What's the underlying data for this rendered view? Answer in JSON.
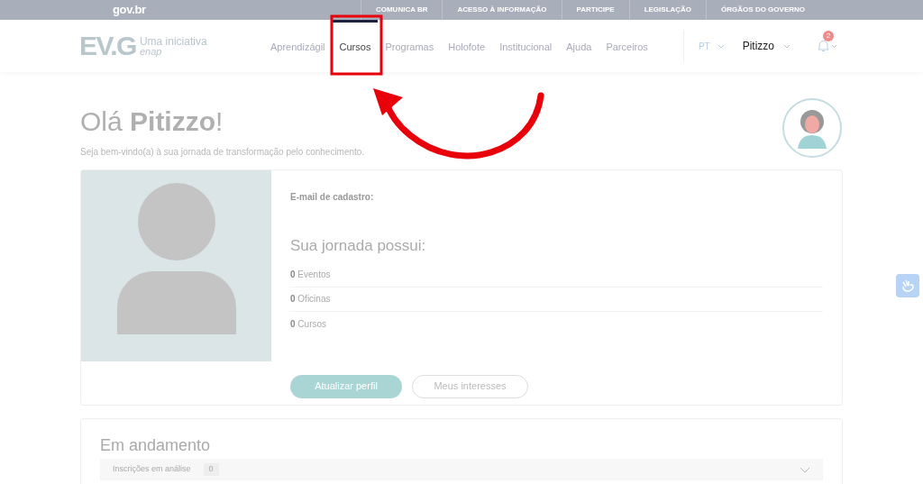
{
  "gov_bar": {
    "logo": "gov.br",
    "links": [
      "COMUNICA BR",
      "ACESSO À INFORMAÇÃO",
      "PARTICIPE",
      "LEGISLAÇÃO",
      "ÓRGÃOS DO GOVERNO"
    ]
  },
  "header": {
    "logo": {
      "mark": "EV.G",
      "tagline": "Uma iniciativa",
      "partner": "enap"
    },
    "nav": [
      {
        "label": "Aprendizágil",
        "selected": false
      },
      {
        "label": "Cursos",
        "selected": true
      },
      {
        "label": "Programas",
        "selected": false
      },
      {
        "label": "Holofote",
        "selected": false
      },
      {
        "label": "Institucional",
        "selected": false
      },
      {
        "label": "Ajuda",
        "selected": false
      },
      {
        "label": "Parceiros",
        "selected": false
      }
    ],
    "language": "PT",
    "user": "Pitizzo",
    "notifications": "2"
  },
  "greeting": {
    "title": "Olá **Pitizzo**!",
    "subtitle": "Seja bem-vindo(a) à sua jornada de transformação pelo conhecimento."
  },
  "profile": {
    "email_label": "E-mail de cadastro:",
    "journey_title": "Sua jornada possui:",
    "stats": [
      {
        "count": "0",
        "label": "Eventos"
      },
      {
        "count": "0",
        "label": "Oficinas"
      },
      {
        "count": "0",
        "label": "Cursos"
      }
    ],
    "buttons": [
      {
        "label": "Atualizar perfil",
        "kind": "primary"
      },
      {
        "label": "Meus interesses",
        "kind": "outline"
      }
    ]
  },
  "in_progress": {
    "title": "Em andamento",
    "rows": [
      {
        "label": "Inscrições em análise",
        "count": "0"
      }
    ]
  }
}
